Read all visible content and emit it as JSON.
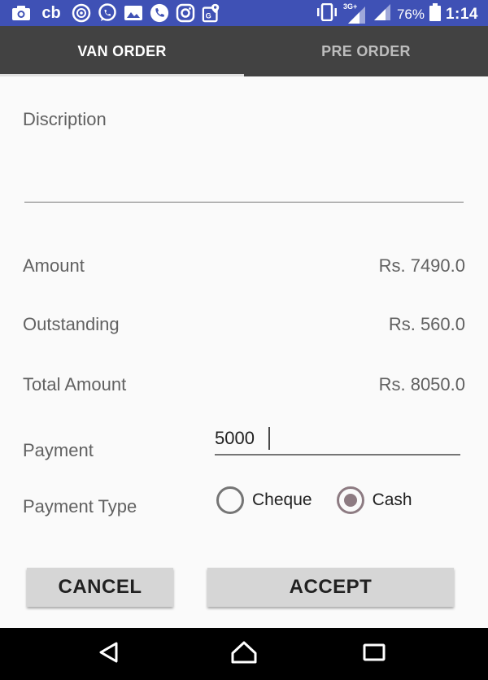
{
  "status_bar": {
    "left_icons": [
      "camera-icon",
      "cb-icon",
      "shareit-icon",
      "whatsapp-icon",
      "gallery-icon",
      "phone-icon",
      "instagram-icon",
      "maps-icon"
    ],
    "cb_text": "cb",
    "battery_percent": "76%",
    "time": "1:14",
    "network": "3G+"
  },
  "tabs": [
    {
      "label": "VAN ORDER",
      "active": true
    },
    {
      "label": "PRE ORDER",
      "active": false
    }
  ],
  "form": {
    "description_label": "Discription",
    "amount_label": "Amount",
    "amount_value": "Rs. 7490.0",
    "outstanding_label": "Outstanding",
    "outstanding_value": "Rs. 560.0",
    "total_label": "Total Amount",
    "total_value": "Rs. 8050.0",
    "payment_label": "Payment",
    "payment_value": "5000",
    "payment_type_label": "Payment Type",
    "payment_options": [
      {
        "label": "Cheque",
        "checked": false
      },
      {
        "label": "Cash",
        "checked": true
      }
    ]
  },
  "buttons": {
    "cancel": "CANCEL",
    "accept": "ACCEPT"
  },
  "nav": [
    "back-icon",
    "home-icon",
    "recents-icon"
  ],
  "colors": {
    "status_bar": "#3f51b5",
    "tab_bar": "#424242",
    "radio_checked": "#8d7b82",
    "button_bg": "#d6d6d6"
  }
}
